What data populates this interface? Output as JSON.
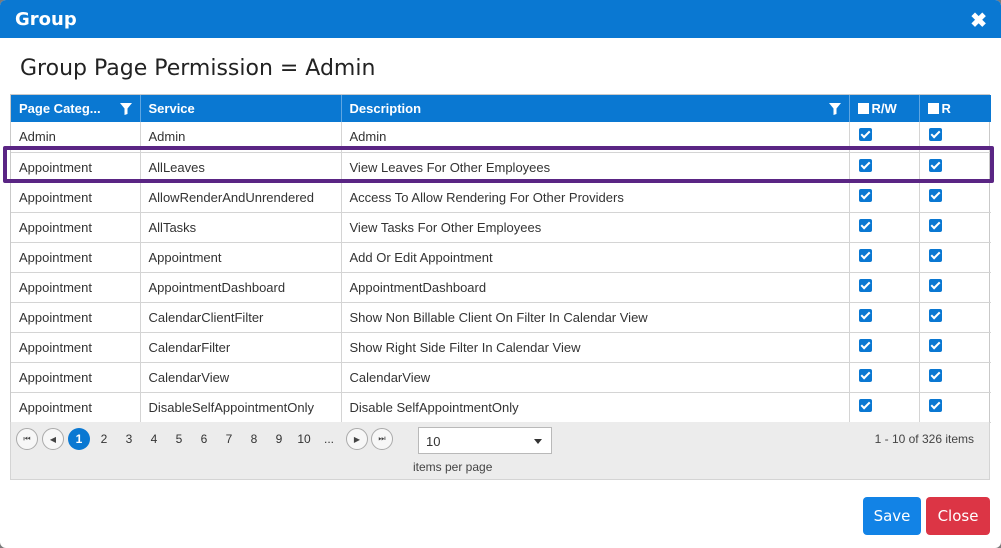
{
  "dialog": {
    "title": "Group",
    "close_glyph": "✖"
  },
  "heading": "Group Page Permission = Admin",
  "grid": {
    "columns": [
      "Page Categ...",
      "Service",
      "Description",
      "R/W",
      "R"
    ],
    "rows": [
      {
        "category": "Admin",
        "service": "Admin",
        "description": "Admin",
        "rw": true,
        "r": true
      },
      {
        "category": "Appointment",
        "service": "AllLeaves",
        "description": "View Leaves For Other Employees",
        "rw": true,
        "r": true
      },
      {
        "category": "Appointment",
        "service": "AllowRenderAndUnrendered",
        "description": "Access To Allow Rendering For Other Providers",
        "rw": true,
        "r": true
      },
      {
        "category": "Appointment",
        "service": "AllTasks",
        "description": "View Tasks For Other Employees",
        "rw": true,
        "r": true
      },
      {
        "category": "Appointment",
        "service": "Appointment",
        "description": "Add Or Edit Appointment",
        "rw": true,
        "r": true
      },
      {
        "category": "Appointment",
        "service": "AppointmentDashboard",
        "description": "AppointmentDashboard",
        "rw": true,
        "r": true
      },
      {
        "category": "Appointment",
        "service": "CalendarClientFilter",
        "description": "Show Non Billable Client On Filter In Calendar View",
        "rw": true,
        "r": true
      },
      {
        "category": "Appointment",
        "service": "CalendarFilter",
        "description": "Show Right Side Filter In Calendar View",
        "rw": true,
        "r": true
      },
      {
        "category": "Appointment",
        "service": "CalendarView",
        "description": "CalendarView",
        "rw": true,
        "r": true
      },
      {
        "category": "Appointment",
        "service": "DisableSelfAppointmentOnly",
        "description": "Disable SelfAppointmentOnly",
        "rw": true,
        "r": true
      }
    ]
  },
  "pager": {
    "pages": [
      "1",
      "2",
      "3",
      "4",
      "5",
      "6",
      "7",
      "8",
      "9",
      "10",
      "..."
    ],
    "current_page": "1",
    "page_size": "10",
    "page_size_label": "items per page",
    "info": "1 - 10 of 326 items"
  },
  "buttons": {
    "save": "Save",
    "close": "Close"
  },
  "colors": {
    "primary": "#0a78d2",
    "danger": "#dc3545",
    "highlight": "#5a2584"
  }
}
